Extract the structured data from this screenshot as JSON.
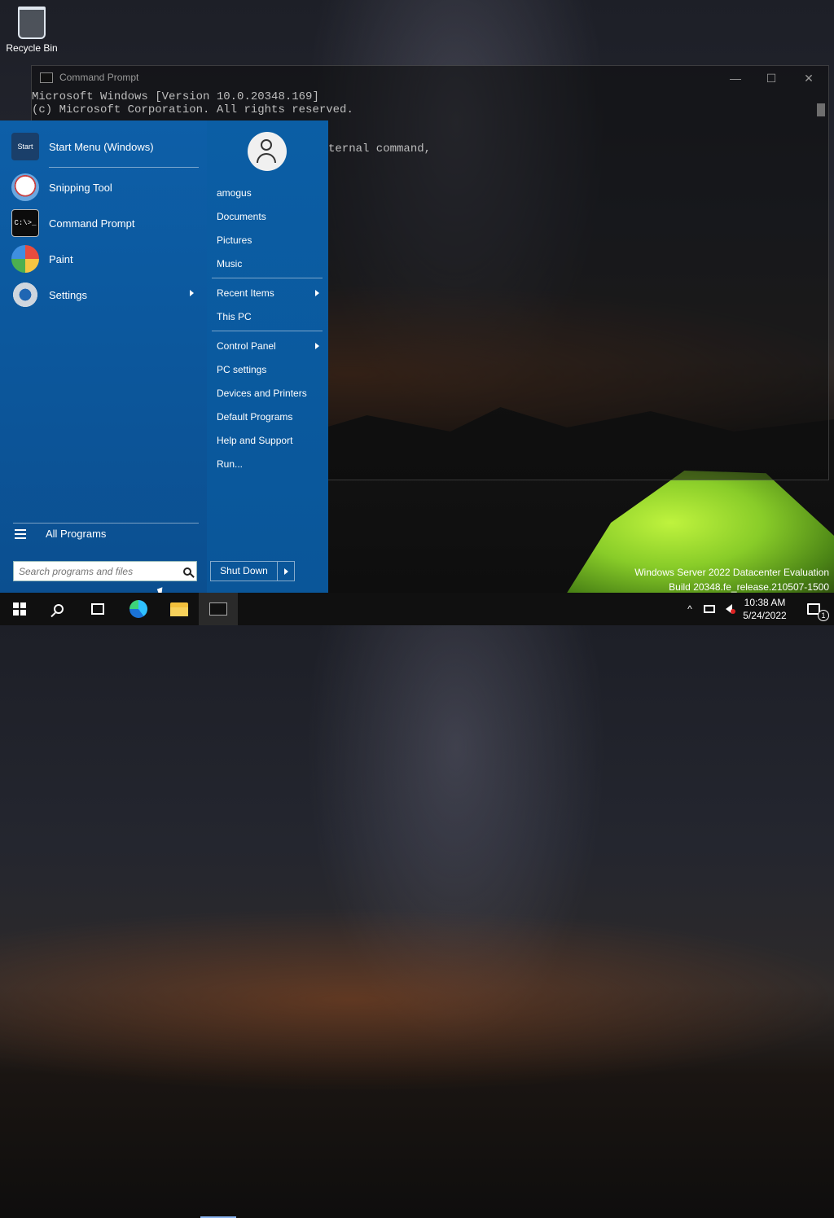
{
  "desktop": {
    "recycle_bin_label": "Recycle Bin"
  },
  "cmd_window": {
    "title": "Command Prompt",
    "lines": [
      "Microsoft Windows [Version 10.0.20348.169]",
      "(c) Microsoft Corporation. All rights reserved."
    ],
    "partial_line": "ternal command,",
    "minimize": "—",
    "maximize": "☐",
    "close": "✕"
  },
  "start_menu": {
    "pinned": [
      {
        "label": "Start Menu (Windows)",
        "icon": "start-menu-icon"
      },
      {
        "label": "Snipping Tool",
        "icon": "snipping-tool-icon"
      },
      {
        "label": "Command Prompt",
        "icon": "command-prompt-icon"
      },
      {
        "label": "Paint",
        "icon": "paint-icon"
      },
      {
        "label": "Settings",
        "icon": "gear-icon"
      }
    ],
    "start_icon_text": "Start",
    "cmd_icon_text": "C:\\>_",
    "all_programs": "All Programs",
    "search_placeholder": "Search programs and files",
    "right": {
      "user": "amogus",
      "documents": "Documents",
      "pictures": "Pictures",
      "music": "Music",
      "recent_items": "Recent Items",
      "this_pc": "This PC",
      "control_panel": "Control Panel",
      "pc_settings": "PC settings",
      "devices_printers": "Devices and Printers",
      "default_programs": "Default Programs",
      "help_support": "Help and Support",
      "run": "Run..."
    },
    "shut_down": "Shut Down"
  },
  "watermark": {
    "line1": "Windows Server 2022 Datacenter Evaluation",
    "line2": "Build 20348.fe_release.210507-1500"
  },
  "taskbar": {
    "time": "10:38 AM",
    "date": "5/24/2022",
    "notification_count": "1",
    "tray_chevron": "^"
  }
}
